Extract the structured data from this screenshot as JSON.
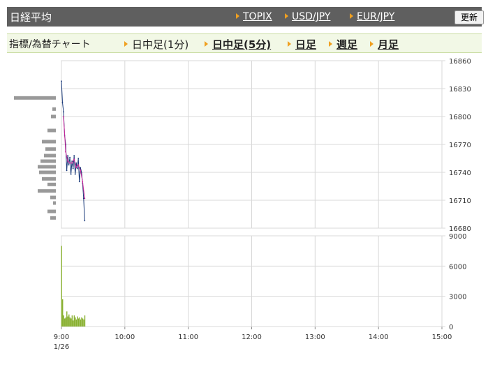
{
  "header": {
    "title": "日経平均",
    "links": [
      "TOPIX",
      "USD/JPY",
      "EUR/JPY"
    ],
    "refresh_label": "更新"
  },
  "subnav": {
    "label": "指標/為替チャート",
    "current": "日中足(1分)",
    "links": [
      "日中足(5分)",
      "日足",
      "週足",
      "月足"
    ]
  },
  "chart_data": [
    {
      "type": "line",
      "y_ticks": [
        "16860",
        "16830",
        "16800",
        "16770",
        "16740",
        "16710",
        "16680"
      ],
      "ylim": [
        16680,
        16860
      ],
      "x_ticks": [
        "9:00",
        "10:00",
        "11:00",
        "12:00",
        "13:00",
        "14:00",
        "15:00"
      ],
      "x_sublabel": "1/26",
      "grid": true,
      "series": [
        {
          "color": "#1a3a7a",
          "x": [
            "9:00",
            "9:01",
            "9:02",
            "9:03",
            "9:04",
            "9:05",
            "9:06",
            "9:07",
            "9:08",
            "9:09",
            "9:10",
            "9:11",
            "9:12",
            "9:13",
            "9:14",
            "9:15",
            "9:16",
            "9:17",
            "9:18",
            "9:19",
            "9:20",
            "9:21",
            "9:22"
          ],
          "values": [
            16838,
            16815,
            16805,
            16780,
            16770,
            16742,
            16758,
            16748,
            16756,
            16738,
            16752,
            16744,
            16758,
            16738,
            16750,
            16744,
            16755,
            16730,
            16745,
            16740,
            16728,
            16712,
            16688
          ]
        },
        {
          "color": "#cc2299",
          "x": [
            "9:02",
            "9:04",
            "9:06",
            "9:08",
            "9:10",
            "9:12",
            "9:14",
            "9:16",
            "9:18",
            "9:20",
            "9:22"
          ],
          "values": [
            16800,
            16762,
            16752,
            16750,
            16750,
            16754,
            16745,
            16748,
            16742,
            16730,
            16712
          ]
        }
      ],
      "price_volume": [
        {
          "price": 16820,
          "amount": 60
        },
        {
          "price": 16808,
          "amount": 5
        },
        {
          "price": 16800,
          "amount": 7
        },
        {
          "price": 16785,
          "amount": 12
        },
        {
          "price": 16773,
          "amount": 20
        },
        {
          "price": 16765,
          "amount": 15
        },
        {
          "price": 16758,
          "amount": 17
        },
        {
          "price": 16752,
          "amount": 22
        },
        {
          "price": 16746,
          "amount": 26
        },
        {
          "price": 16740,
          "amount": 24
        },
        {
          "price": 16733,
          "amount": 20
        },
        {
          "price": 16727,
          "amount": 12
        },
        {
          "price": 16720,
          "amount": 26
        },
        {
          "price": 16713,
          "amount": 8
        },
        {
          "price": 16707,
          "amount": 4
        },
        {
          "price": 16698,
          "amount": 12
        },
        {
          "price": 16691,
          "amount": 8
        }
      ]
    },
    {
      "type": "bar",
      "y_ticks": [
        "9000",
        "6000",
        "3000",
        "0"
      ],
      "ylim": [
        0,
        9000
      ],
      "color": "#88b030",
      "x": [
        "9:00",
        "9:01",
        "9:02",
        "9:03",
        "9:04",
        "9:05",
        "9:06",
        "9:07",
        "9:08",
        "9:09",
        "9:10",
        "9:11",
        "9:12",
        "9:13",
        "9:14",
        "9:15",
        "9:16",
        "9:17",
        "9:18",
        "9:19",
        "9:20",
        "9:21",
        "9:22"
      ],
      "values": [
        8000,
        2700,
        1100,
        800,
        900,
        1500,
        1000,
        1200,
        900,
        800,
        1100,
        600,
        1100,
        900,
        700,
        1000,
        800,
        900,
        700,
        900,
        800,
        700,
        1100
      ]
    }
  ]
}
